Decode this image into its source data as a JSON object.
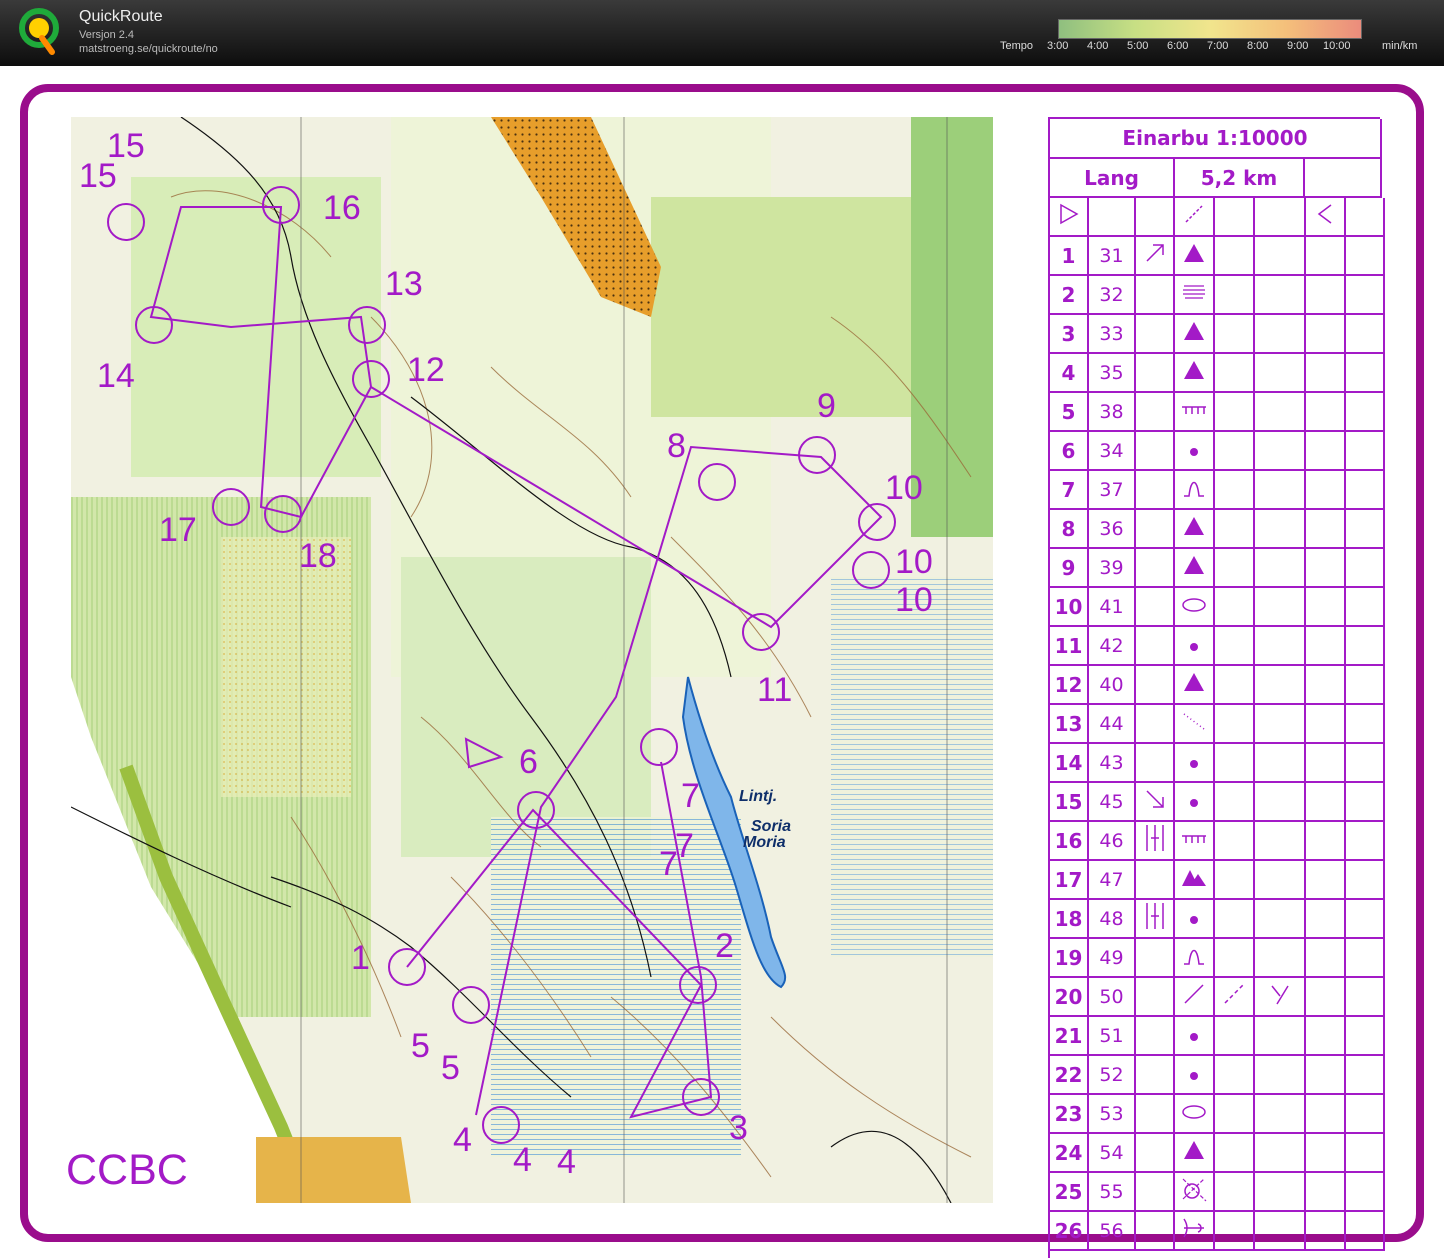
{
  "app": {
    "title": "QuickRoute",
    "version": "Versjon 2.4",
    "url": "matstroeng.se/quickroute/no"
  },
  "tempo_scale": {
    "label": "Tempo",
    "ticks": [
      "3:00",
      "4:00",
      "5:00",
      "6:00",
      "7:00",
      "8:00",
      "9:00",
      "10:00"
    ],
    "unit": "min/km"
  },
  "map": {
    "club_label": "CCBC",
    "lake_labels": [
      "Lintj.",
      "Soria",
      "Moria"
    ],
    "route_color": "#a31ac7",
    "control_labels": [
      "1",
      "2",
      "3",
      "4",
      "4",
      "4",
      "5",
      "5",
      "6",
      "7",
      "7",
      "7",
      "8",
      "9",
      "10",
      "10",
      "10",
      "11",
      "12",
      "13",
      "14",
      "15",
      "15",
      "16",
      "17",
      "18"
    ]
  },
  "description_sheet": {
    "title": "Einarbu 1:10000",
    "course": "Lang",
    "length": "5,2 km",
    "controls": [
      {
        "num": "1",
        "code": "31",
        "symbol": "triangle",
        "dir": "ne"
      },
      {
        "num": "2",
        "code": "32",
        "symbol": "terrace"
      },
      {
        "num": "3",
        "code": "33",
        "symbol": "triangle"
      },
      {
        "num": "4",
        "code": "35",
        "symbol": "triangle"
      },
      {
        "num": "5",
        "code": "38",
        "symbol": "fence"
      },
      {
        "num": "6",
        "code": "34",
        "symbol": "dot"
      },
      {
        "num": "7",
        "code": "37",
        "symbol": "knoll"
      },
      {
        "num": "8",
        "code": "36",
        "symbol": "triangle"
      },
      {
        "num": "9",
        "code": "39",
        "symbol": "triangle"
      },
      {
        "num": "10",
        "code": "41",
        "symbol": "ellipse"
      },
      {
        "num": "11",
        "code": "42",
        "symbol": "dot"
      },
      {
        "num": "12",
        "code": "40",
        "symbol": "triangle"
      },
      {
        "num": "13",
        "code": "44",
        "symbol": "dotline"
      },
      {
        "num": "14",
        "code": "43",
        "symbol": "dot"
      },
      {
        "num": "15",
        "code": "45",
        "symbol": "dot",
        "dir": "se"
      },
      {
        "num": "16",
        "code": "46",
        "symbol": "fence",
        "mark": "bars"
      },
      {
        "num": "17",
        "code": "47",
        "symbol": "doubletri"
      },
      {
        "num": "18",
        "code": "48",
        "symbol": "dot",
        "mark": "bars"
      },
      {
        "num": "19",
        "code": "49",
        "symbol": "knoll"
      },
      {
        "num": "20",
        "code": "50",
        "symbol": "slash",
        "extra": "dashslash",
        "extra2": "fork"
      },
      {
        "num": "21",
        "code": "51",
        "symbol": "dot"
      },
      {
        "num": "22",
        "code": "52",
        "symbol": "dot"
      },
      {
        "num": "23",
        "code": "53",
        "symbol": "ellipse"
      },
      {
        "num": "24",
        "code": "54",
        "symbol": "triangle"
      },
      {
        "num": "25",
        "code": "55",
        "symbol": "crossed"
      },
      {
        "num": "26",
        "code": "56",
        "symbol": "tee"
      }
    ]
  }
}
